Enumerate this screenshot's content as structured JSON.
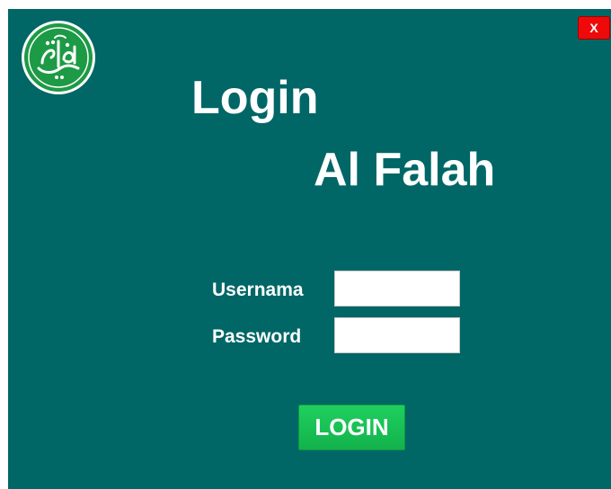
{
  "window": {
    "close_label": "X"
  },
  "logo": {
    "icon": "quran-calligraphy-logo",
    "text": "قرآني"
  },
  "header": {
    "title": "Login",
    "subtitle": "Al Falah"
  },
  "form": {
    "username_label": "Usernama",
    "username_value": "",
    "password_label": "Password",
    "password_value": "",
    "login_label": "LOGIN"
  },
  "colors": {
    "background": "#006666",
    "login_button": "#17c055",
    "close_button": "#ee0a0a",
    "logo_green": "#1d9a45"
  }
}
